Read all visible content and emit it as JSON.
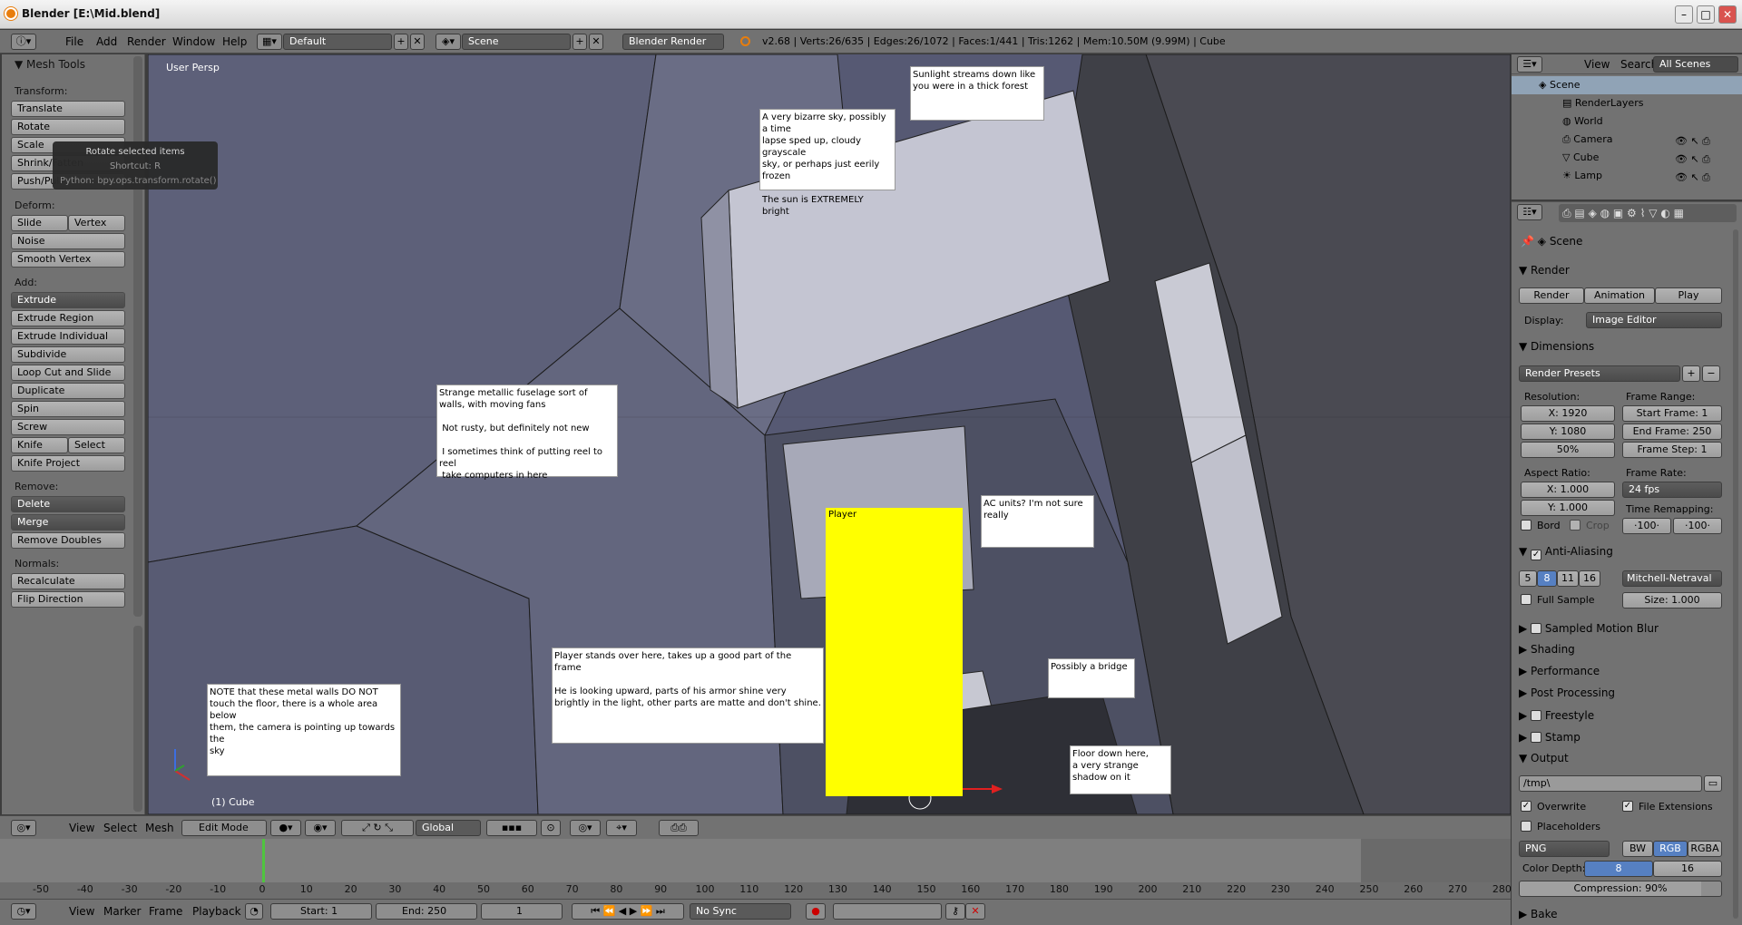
{
  "window": {
    "title": "Blender [E:\\Mid.blend]",
    "minimize": "–",
    "maximize": "□",
    "close": "✕"
  },
  "info": {
    "menus": [
      "File",
      "Add",
      "Render",
      "Window",
      "Help"
    ],
    "screen": "Default",
    "scene": "Scene",
    "engine": "Blender Render",
    "stats": "v2.68 | Verts:26/635 | Edges:26/1072 | Faces:1/441 | Tris:1262 | Mem:10.50M (9.99M) | Cube"
  },
  "tools": {
    "panel_title": "Mesh Tools",
    "transform_label": "Transform:",
    "translate": "Translate",
    "rotate": "Rotate",
    "scale": "Scale",
    "shrink": "Shrink/Fatten",
    "pushpull": "Push/Pull",
    "deform_label": "Deform:",
    "slide_edge": "Slide Edge",
    "vertex": "Vertex",
    "noise": "Noise",
    "smooth_vertex": "Smooth Vertex",
    "add_label": "Add:",
    "extrude": "Extrude",
    "extrude_region": "Extrude Region",
    "extrude_individual": "Extrude Individual",
    "subdivide": "Subdivide",
    "loop_cut": "Loop Cut and Slide",
    "duplicate": "Duplicate",
    "spin": "Spin",
    "screw": "Screw",
    "knife": "Knife",
    "select": "Select",
    "knife_project": "Knife Project",
    "remove_label": "Remove:",
    "delete": "Delete",
    "merge": "Merge",
    "remove_doubles": "Remove Doubles",
    "normals_label": "Normals:",
    "recalculate": "Recalculate",
    "flip_direction": "Flip Direction"
  },
  "tooltip": {
    "title": "Rotate selected items",
    "shortcut": "Shortcut: R",
    "python": "Python: bpy.ops.transform.rotate()"
  },
  "viewport": {
    "label": "User Persp",
    "object": "(1) Cube",
    "player": "Player",
    "notes": {
      "sky": "A very bizarre sky, possibly a time\nlapse sped up, cloudy grayscale\nsky, or perhaps just eerily frozen\n\nThe sun is EXTREMELY bright",
      "sunlight": "Sunlight streams down like\nyou were in a thick forest",
      "fuselage": "Strange metallic fuselage sort of\nwalls, with moving fans\n\n Not rusty, but definitely not new\n\n I sometimes think of putting reel to reel\n take computers in here",
      "ac": "AC units? I'm not sure\nreally",
      "player_stands": "Player stands over here, takes up a good part of the frame\n\nHe is looking upward, parts of his armor shine very\nbrightly in the light, other parts are matte and don't shine.",
      "bridge": "Possibly a bridge",
      "floor": "Floor down here,\na very strange\nshadow on it",
      "note_walls": "NOTE that these metal walls DO NOT\ntouch the floor, there is a whole area below\nthem, the camera is pointing up towards the\nsky"
    }
  },
  "view_header": {
    "menus": [
      "View",
      "Select",
      "Mesh"
    ],
    "mode": "Edit Mode",
    "orientation": "Global"
  },
  "timeline": {
    "ticks": [
      "-50",
      "-40",
      "-30",
      "-20",
      "-10",
      "0",
      "10",
      "20",
      "30",
      "40",
      "50",
      "60",
      "70",
      "80",
      "90",
      "100",
      "110",
      "120",
      "130",
      "140",
      "150",
      "160",
      "170",
      "180",
      "190",
      "200",
      "210",
      "220",
      "230",
      "240",
      "250",
      "260",
      "270",
      "280"
    ],
    "menus": [
      "View",
      "Marker",
      "Frame",
      "Playback"
    ],
    "start": "Start: 1",
    "end": "End: 250",
    "current": "1",
    "sync": "No Sync"
  },
  "outliner": {
    "menus": [
      "View",
      "Search"
    ],
    "filter": "All Scenes",
    "items": [
      "Scene",
      "RenderLayers",
      "World",
      "Camera",
      "Cube",
      "Lamp"
    ]
  },
  "properties": {
    "context": "Scene",
    "render_title": "Render",
    "render_btn": "Render",
    "animation_btn": "Animation",
    "play_btn": "Play",
    "display_label": "Display:",
    "display_value": "Image Editor",
    "dimensions_title": "Dimensions",
    "presets": "Render Presets",
    "resolution_label": "Resolution:",
    "res_x": "X: 1920",
    "res_y": "Y: 1080",
    "res_pct": "50%",
    "frame_range_label": "Frame Range:",
    "start_frame": "Start Frame: 1",
    "end_frame": "End Frame: 250",
    "frame_step": "Frame Step: 1",
    "aspect_label": "Aspect Ratio:",
    "aspect_x": "X: 1.000",
    "aspect_y": "Y: 1.000",
    "frame_rate_label": "Frame Rate:",
    "frame_rate": "24 fps",
    "bord": "Bord",
    "crop": "Crop",
    "time_remap_label": "Time Remapping:",
    "remap_old": "·100·",
    "remap_new": "·100·",
    "aa_title": "Anti-Aliasing",
    "aa_samples": [
      "5",
      "8",
      "11",
      "16"
    ],
    "aa_filter": "Mitchell-Netraval",
    "full_sample": "Full Sample",
    "aa_size": "Size: 1.000",
    "panels": [
      "Sampled Motion Blur",
      "Shading",
      "Performance",
      "Post Processing",
      "Freestyle",
      "Stamp"
    ],
    "output_title": "Output",
    "output_path": "/tmp\\",
    "overwrite": "Overwrite",
    "file_ext": "File Extensions",
    "placeholders": "Placeholders",
    "format": "PNG",
    "bw": "BW",
    "rgb": "RGB",
    "rgba": "RGBA",
    "color_depth_label": "Color Depth:",
    "depth8": "8",
    "depth16": "16",
    "compression": "Compression: 90%",
    "bake_title": "Bake"
  }
}
